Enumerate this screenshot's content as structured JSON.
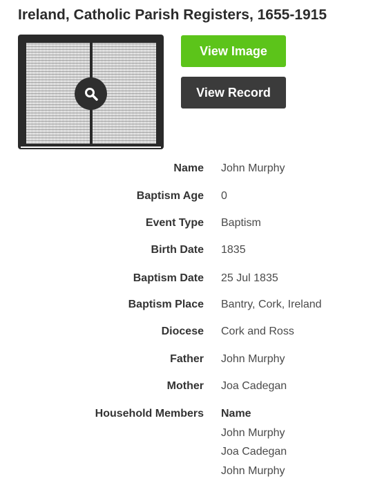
{
  "title": "Ireland, Catholic Parish Registers, 1655-1915",
  "buttons": {
    "view_image": "View Image",
    "view_record": "View Record"
  },
  "icons": {
    "zoom": "magnifier-icon"
  },
  "colors": {
    "view_image_bg": "#5cc41a",
    "view_record_bg": "#3b3b3b"
  },
  "fields": [
    {
      "label": "Name",
      "value": "John Murphy"
    },
    {
      "label": "Baptism Age",
      "value": "0"
    },
    {
      "label": "Event Type",
      "value": "Baptism"
    },
    {
      "label": "Birth Date",
      "value": "1835"
    },
    {
      "label": "Baptism Date",
      "value": "25 Jul 1835"
    },
    {
      "label": "Baptism Place",
      "value": "Bantry, Cork, Ireland"
    },
    {
      "label": "Diocese",
      "value": "Cork and Ross"
    },
    {
      "label": "Father",
      "value": "John Murphy"
    },
    {
      "label": "Mother",
      "value": "Joa Cadegan"
    }
  ],
  "household": {
    "label": "Household Members",
    "column_header": "Name",
    "members": [
      "John Murphy",
      "Joa Cadegan",
      "John Murphy"
    ]
  }
}
